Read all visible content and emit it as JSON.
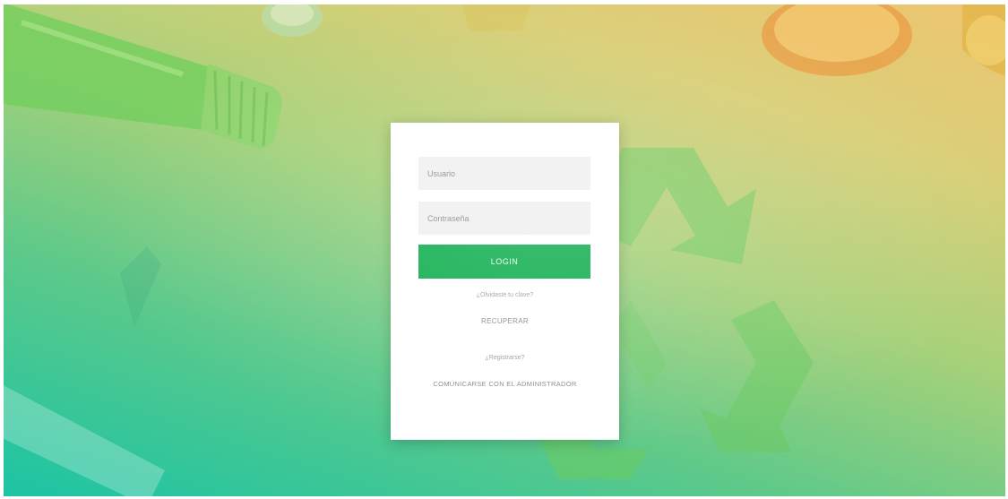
{
  "login": {
    "username_placeholder": "Usuario",
    "password_placeholder": "Contraseña",
    "login_button": "LOGIN",
    "forgot_prompt": "¿Olvidaste tu clave?",
    "forgot_link": "RECUPERAR",
    "register_prompt": "¿Registrarse?",
    "register_link": "COMUNICARSE CON EL ADMINISTRADOR"
  },
  "colors": {
    "accent": "#0fae4e",
    "gradient_bottom_left": "#1cc4a4",
    "gradient_top_right": "#eec470",
    "field_background": "#f0f0f0"
  },
  "background": {
    "icon": "recycle-icon"
  }
}
